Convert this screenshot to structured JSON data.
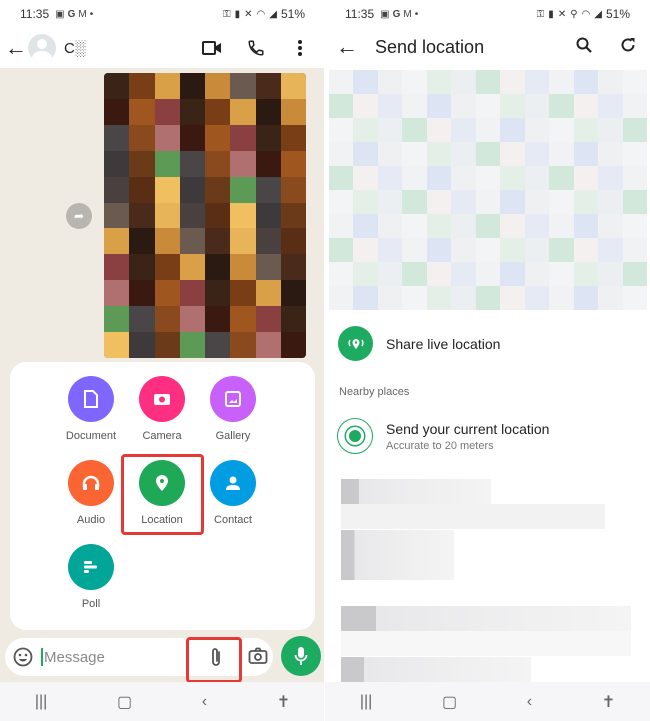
{
  "left_screen": {
    "status_bar": {
      "time": "11:35",
      "notif_icons": [
        "image-icon",
        "google-icon",
        "gmail-icon",
        "dot"
      ],
      "battery": "51%"
    },
    "header": {
      "contact_name": "C░",
      "actions": [
        "video-call-icon",
        "voice-call-icon",
        "more-options-icon"
      ]
    },
    "attachment_menu": {
      "items": [
        {
          "label": "Document",
          "icon": "document-icon",
          "color": "#7f66ff"
        },
        {
          "label": "Camera",
          "icon": "camera-icon",
          "color": "#fe2f80"
        },
        {
          "label": "Gallery",
          "icon": "gallery-icon",
          "color": "#c861fa"
        },
        {
          "label": "Audio",
          "icon": "headphones-icon",
          "color": "#fa6533"
        },
        {
          "label": "Location",
          "icon": "location-pin-icon",
          "color": "#1fa855"
        },
        {
          "label": "Contact",
          "icon": "contact-icon",
          "color": "#009de2"
        },
        {
          "label": "Poll",
          "icon": "poll-icon",
          "color": "#02a698"
        }
      ],
      "highlighted": "Location"
    },
    "composer": {
      "placeholder": "Message",
      "highlighted": "attach-icon"
    },
    "accent": "#1daa61",
    "highlight_color": "#e53935"
  },
  "right_screen": {
    "status_bar": {
      "time": "11:35",
      "battery": "51%"
    },
    "header": {
      "title": "Send location"
    },
    "share_live": {
      "label": "Share live location"
    },
    "section_label": "Nearby places",
    "current_location": {
      "title": "Send your current location",
      "subtitle": "Accurate to 20 meters"
    }
  }
}
